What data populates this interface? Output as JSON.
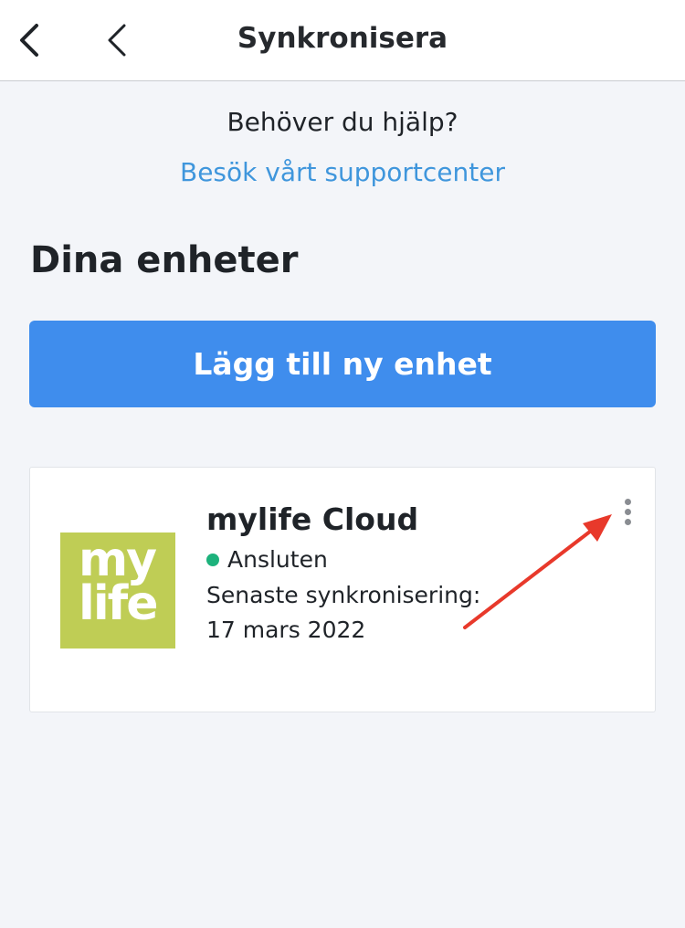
{
  "header": {
    "title": "Synkronisera",
    "back_icon": "chevron-left-icon",
    "secondary_back_icon": "chevron-left-icon"
  },
  "help": {
    "question": "Behöver du hjälp?",
    "support_link": "Besök vårt supportcenter"
  },
  "devices": {
    "section_title": "Dina enheter",
    "add_button_label": "Lägg till ny enhet",
    "items": [
      {
        "logo_text_line1": "my",
        "logo_text_line2": "life",
        "name": "mylife Cloud",
        "status": "Ansluten",
        "sync_label": "Senaste synkronisering:",
        "sync_date": "17 mars 2022",
        "menu_icon": "more-vertical-icon"
      }
    ]
  },
  "colors": {
    "accent": "#3f8ded",
    "link": "#3f96dc",
    "status_connected": "#1db27c",
    "logo_background": "#bfcd55",
    "annotation_arrow": "#e8392b"
  }
}
